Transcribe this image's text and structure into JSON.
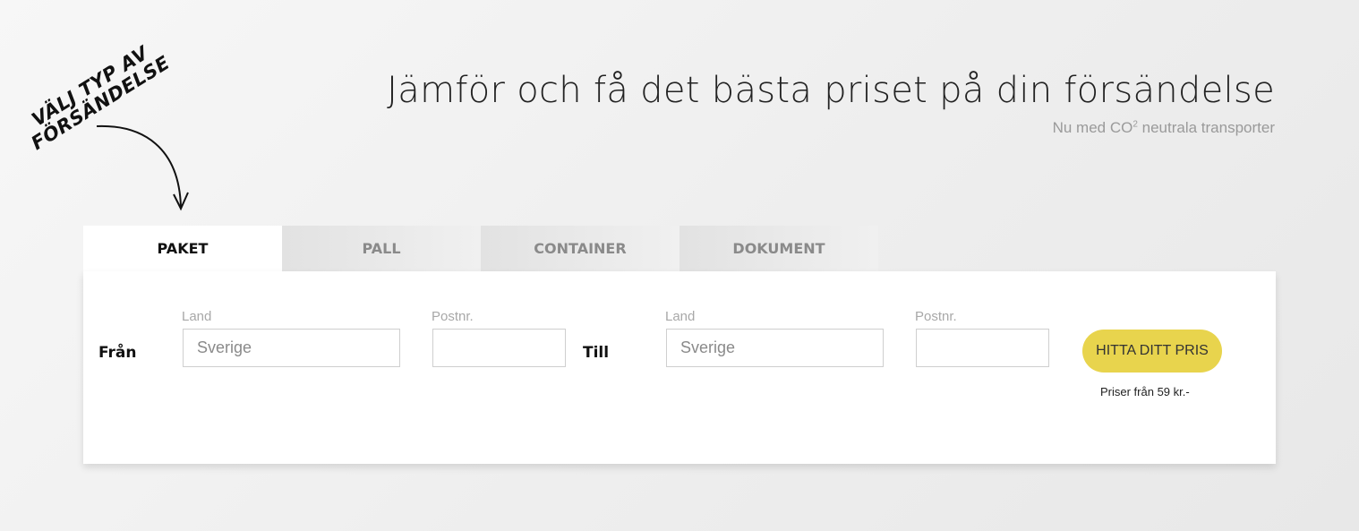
{
  "annotation": {
    "line1": "VÄLJ TYP AV",
    "line2": "FÖRSÄNDELSE"
  },
  "header": {
    "title": "Jämför och få det bästa priset på din försändelse",
    "subtitle_prefix": "Nu med CO",
    "subtitle_sup": "2",
    "subtitle_suffix": " neutrala transporter"
  },
  "tabs": [
    {
      "label": "PAKET",
      "active": true
    },
    {
      "label": "PALL",
      "active": false
    },
    {
      "label": "CONTAINER",
      "active": false
    },
    {
      "label": "DOKUMENT",
      "active": false
    }
  ],
  "form": {
    "from_label": "Från",
    "to_label": "Till",
    "from_country_label": "Land",
    "from_country_placeholder": "Sverige",
    "from_postal_label": "Postnr.",
    "from_postal_value": "",
    "to_country_label": "Land",
    "to_country_placeholder": "Sverige",
    "to_postal_label": "Postnr.",
    "to_postal_value": "",
    "submit_label": "HITTA DITT PRIS",
    "price_note": "Priser från 59 kr.-"
  },
  "colors": {
    "accent_button": "#e8d44d",
    "active_tab": "#ffffff",
    "inactive_tab": "#e2e2e2"
  }
}
